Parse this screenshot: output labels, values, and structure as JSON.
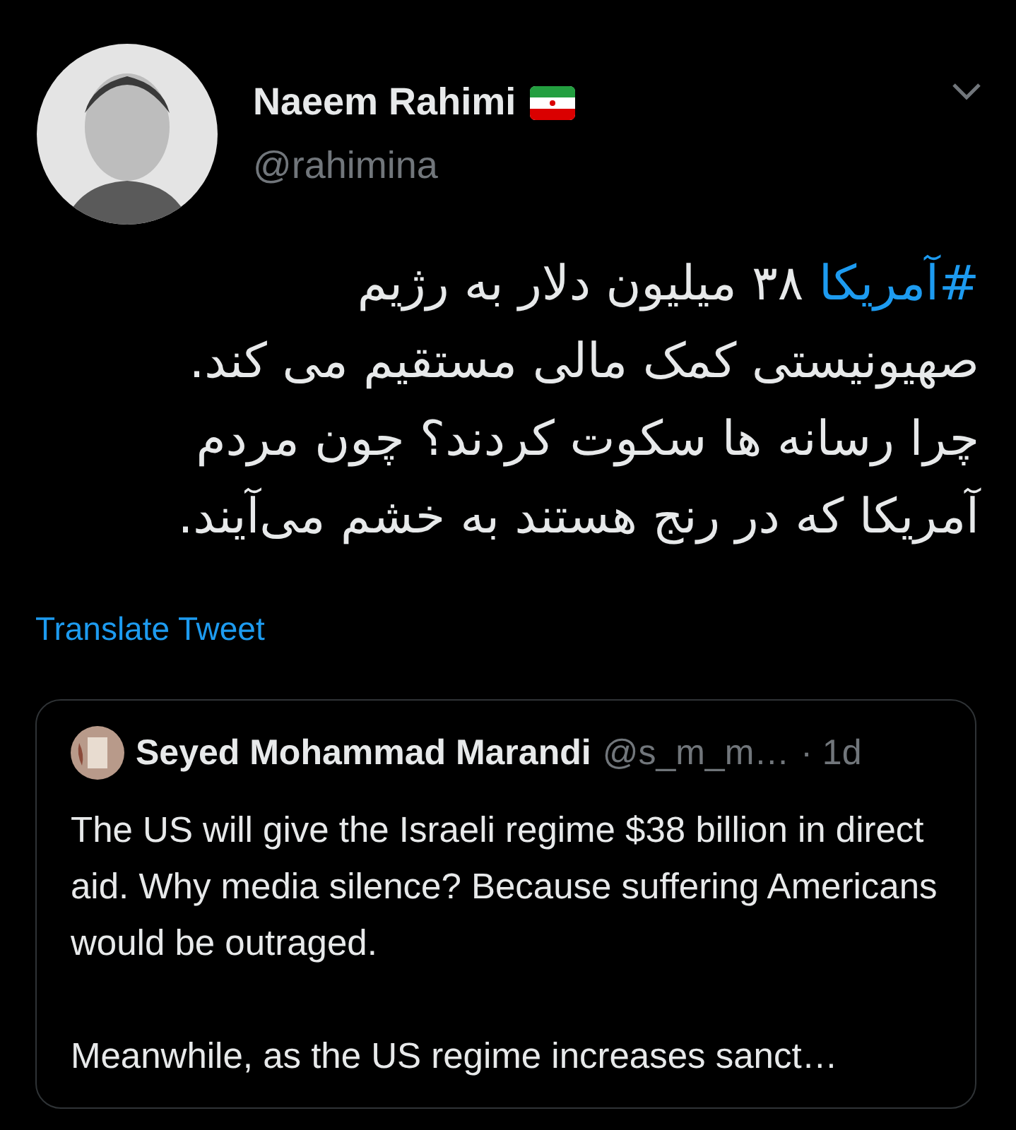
{
  "author": {
    "name": "Naeem Rahimi",
    "handle": "@rahimina"
  },
  "tweet_text": [
    {
      "kind": "hashtag",
      "text": "#آمریکا"
    },
    {
      "kind": "plain",
      "text": " ۳۸ میلیون دلار به رژیم\nصهیونیستی کمک مالی مستقیم می کند.\nچرا رسانه ها سکوت کردند؟ چون مردم\nآمریکا که در رنج هستند به خشم می‌آیند."
    }
  ],
  "translate_link": "Translate Tweet",
  "quoted_tweet": {
    "name": "Seyed Mohammad Marandi",
    "handle": "@s_m_m…",
    "time": "· 1d",
    "paragraphs": [
      "The US will give the Israeli regime $38 billion in direct aid. Why media silence? Because suffering Americans would be outraged.",
      "Meanwhile, as the US regime increases sanct…"
    ]
  }
}
